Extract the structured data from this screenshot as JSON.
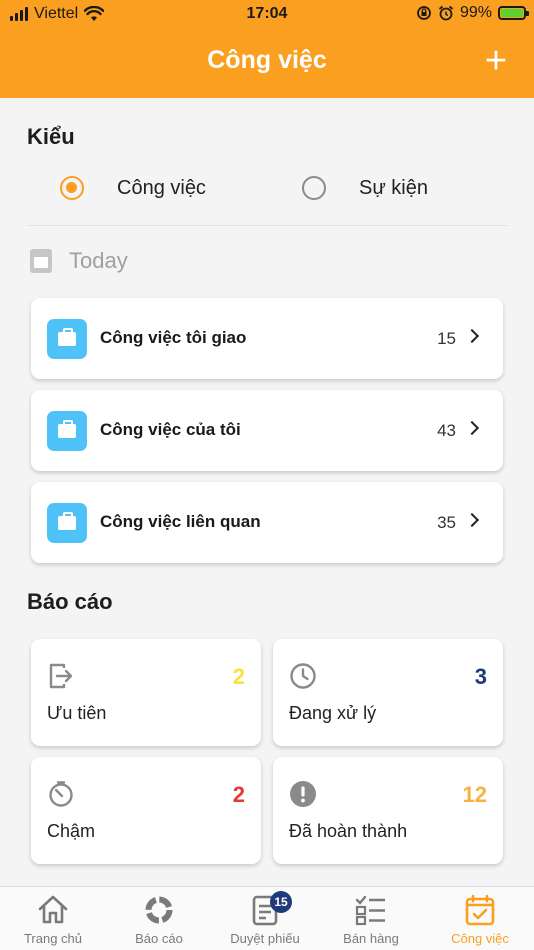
{
  "status_bar": {
    "carrier": "Viettel",
    "time": "17:04",
    "battery": "99%"
  },
  "header": {
    "title": "Công việc",
    "add_symbol": "+"
  },
  "type_section": {
    "title": "Kiểu",
    "options": [
      {
        "label": "Công việc",
        "selected": true
      },
      {
        "label": "Sự kiện",
        "selected": false
      }
    ]
  },
  "today": {
    "label": "Today"
  },
  "tasks": [
    {
      "label": "Công việc tôi giao",
      "count": "15"
    },
    {
      "label": "Công việc của tôi",
      "count": "43"
    },
    {
      "label": "Công việc liên quan",
      "count": "35"
    }
  ],
  "report": {
    "title": "Báo cáo",
    "stats": [
      {
        "label": "Ưu tiên",
        "value": "2",
        "color": "#f6e33b",
        "icon": "exit-icon"
      },
      {
        "label": "Đang xử lý",
        "value": "3",
        "color": "#1f3a7a",
        "icon": "clock-icon"
      },
      {
        "label": "Chậm",
        "value": "2",
        "color": "#e53935",
        "icon": "timer-off-icon"
      },
      {
        "label": "Đã hoàn thành",
        "value": "12",
        "color": "#fab142",
        "icon": "alert-circle-icon"
      }
    ]
  },
  "tabs": [
    {
      "label": "Trang chủ",
      "icon": "home-icon"
    },
    {
      "label": "Báo cáo",
      "icon": "chart-icon"
    },
    {
      "label": "Duyệt phiếu",
      "icon": "document-icon",
      "badge": "15"
    },
    {
      "label": "Bán hàng",
      "icon": "checklist-icon"
    },
    {
      "label": "Công việc",
      "icon": "calendar-check-icon",
      "active": true
    }
  ],
  "colors": {
    "accent": "#fa9f1f",
    "task_icon_bg": "#4fc3f7"
  }
}
